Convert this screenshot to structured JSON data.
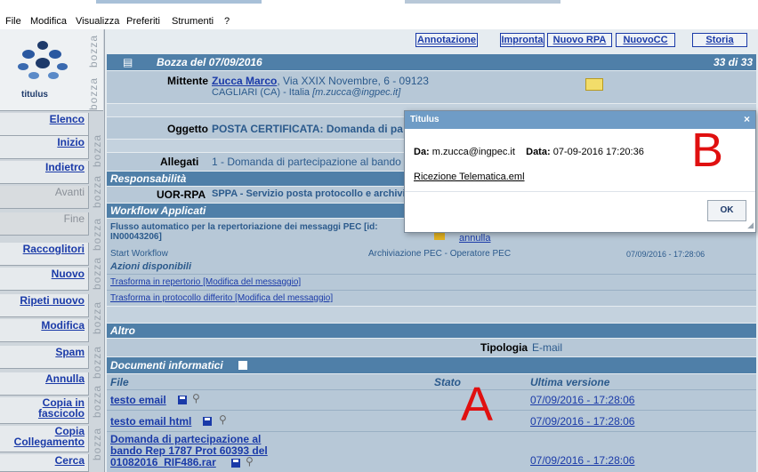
{
  "menu": [
    "File",
    "Modifica",
    "Visualizza",
    "Preferiti",
    "Strumenti",
    "?"
  ],
  "logo": {
    "text": "titulus",
    "stamp": "bozza"
  },
  "sidebar": {
    "items": [
      {
        "label": "Elenco",
        "enabled": true
      },
      {
        "label": "Inizio",
        "enabled": true
      },
      {
        "label": "Indietro",
        "enabled": true
      },
      {
        "label": "Avanti",
        "enabled": false
      },
      {
        "label": "Fine",
        "enabled": false
      },
      {
        "label": "Raccoglitori",
        "enabled": true
      },
      {
        "label": "Nuovo",
        "enabled": true
      },
      {
        "label": "Ripeti nuovo",
        "enabled": true
      },
      {
        "label": "Modifica",
        "enabled": true
      },
      {
        "label": "Spam",
        "enabled": true
      },
      {
        "label": "Annulla",
        "enabled": true
      },
      {
        "label": "Copia in fascicolo",
        "enabled": true
      },
      {
        "label": "Copia Collegamento",
        "enabled": true
      },
      {
        "label": "Cerca",
        "enabled": true
      }
    ]
  },
  "toolbar": {
    "annotazione": "Annotazione",
    "impronta": "Impronta",
    "nuovo_rpa": "Nuovo RPA",
    "nuovo_cc": "NuovoCC",
    "storia": "Storia"
  },
  "header": {
    "title": "Bozza del 07/09/2016",
    "counter": "33 di 33"
  },
  "mittente": {
    "label": "Mittente",
    "name": "Zucca Marco",
    "address": ", Via XXIX Novembre, 6 - 09123",
    "city": "CAGLIARI (CA) - Italia",
    "email": "[m.zucca@ingpec.it]"
  },
  "oggetto": {
    "label": "Oggetto",
    "value": "POSTA CERTIFICATA: Domanda di pa"
  },
  "allegati": {
    "label": "Allegati",
    "value": "1 -  Domanda di partecipazione al bando"
  },
  "responsabilita": {
    "title": "Responsabilità",
    "label": "UOR-RPA",
    "value": "SPPA - Servizio posta protocollo e archivio"
  },
  "workflow": {
    "title": "Workflow Applicati",
    "flow_line1": "Flusso automatico per la repertoriazione dei messaggi PEC [id:",
    "flow_line2": "IN00043206]",
    "annulla": "annulla",
    "start": "Start Workflow",
    "archiviazione": "Archiviazione PEC - Operatore PEC",
    "date": "07/09/2016  -  17:28:06",
    "azioni_title": "Azioni disponibili",
    "azione1": "Trasforma in repertorio [Modifica del messaggio]",
    "azione2": "Trasforma in protocollo differito [Modifica del messaggio]"
  },
  "altro": {
    "title": "Altro",
    "tipologia_label": "Tipologia",
    "tipologia_value": "E-mail"
  },
  "documenti": {
    "title": "Documenti informatici",
    "col_file": "File",
    "col_stato": "Stato",
    "col_versione": "Ultima versione",
    "rows": [
      {
        "name": "testo email",
        "date": "07/09/2016 - 17:28:06"
      },
      {
        "name": "testo email html",
        "date": "07/09/2016 - 17:28:06"
      },
      {
        "name_l1": "Domanda di partecipazione al",
        "name_l2": "bando Rep 1787 Prot 60393 del",
        "name_l3": "01082016_RIF486.rar",
        "date": "07/09/2016 - 17:28:06"
      }
    ]
  },
  "dialog": {
    "title": "Titulus",
    "close": "×",
    "da_label": "Da:",
    "da_value": "m.zucca@ingpec.it",
    "data_label": "Data:",
    "data_value": "07-09-2016 17:20:36",
    "file": "Ricezione Telematica.eml",
    "ok": "OK"
  },
  "annotations": {
    "a": "A",
    "b": "B"
  }
}
